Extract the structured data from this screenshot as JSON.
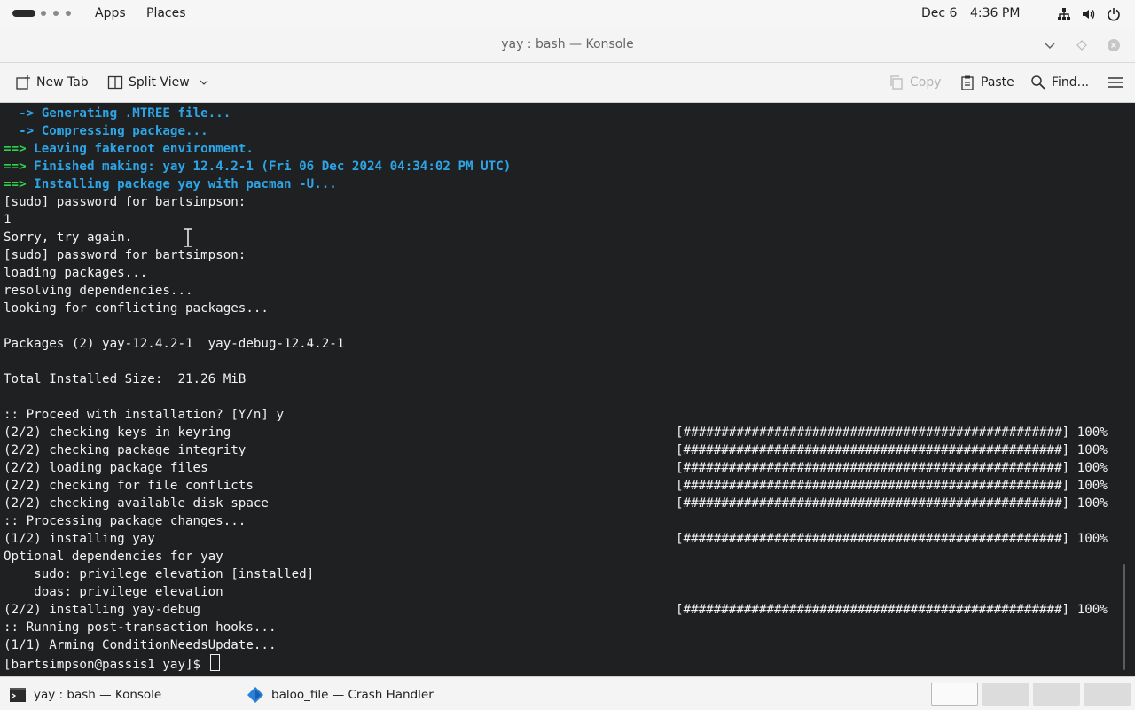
{
  "topbar": {
    "apps_label": "Apps",
    "places_label": "Places",
    "date": "Dec 6",
    "time": "4:36 PM",
    "tray_icons": [
      "network-icon",
      "volume-icon",
      "power-icon"
    ]
  },
  "window": {
    "title": "yay : bash — Konsole"
  },
  "toolbar": {
    "new_tab_label": "New Tab",
    "split_view_label": "Split View",
    "copy_label": "Copy",
    "paste_label": "Paste",
    "find_label": "Find..."
  },
  "terminal": {
    "colors": {
      "background": "#1e2022",
      "blue": "#2da5e6",
      "green": "#2bd24c"
    },
    "lines": [
      {
        "segments": [
          {
            "text": "  -> ",
            "color": "blue"
          },
          {
            "text": "Generating .MTREE file...",
            "color": "blue"
          }
        ],
        "bold": true
      },
      {
        "segments": [
          {
            "text": "  -> ",
            "color": "blue"
          },
          {
            "text": "Compressing package...",
            "color": "blue"
          }
        ],
        "bold": true
      },
      {
        "segments": [
          {
            "text": "==> ",
            "color": "green"
          },
          {
            "text": "Leaving fakeroot environment.",
            "color": "blue"
          }
        ],
        "bold": true
      },
      {
        "segments": [
          {
            "text": "==> ",
            "color": "green"
          },
          {
            "text": "Finished making: yay 12.4.2-1 (Fri 06 Dec 2024 04:34:02 PM UTC)",
            "color": "blue"
          }
        ],
        "bold": true
      },
      {
        "segments": [
          {
            "text": "==> ",
            "color": "green"
          },
          {
            "text": "Installing package yay with pacman -U...",
            "color": "blue"
          }
        ],
        "bold": true
      },
      {
        "segments": [
          {
            "text": "[sudo] password for bartsimpson:"
          }
        ]
      },
      {
        "segments": [
          {
            "text": "1"
          }
        ]
      },
      {
        "segments": [
          {
            "text": "Sorry, try again."
          }
        ]
      },
      {
        "segments": [
          {
            "text": "[sudo] password for bartsimpson:"
          }
        ]
      },
      {
        "segments": [
          {
            "text": "loading packages..."
          }
        ]
      },
      {
        "segments": [
          {
            "text": "resolving dependencies..."
          }
        ]
      },
      {
        "segments": [
          {
            "text": "looking for conflicting packages..."
          }
        ]
      },
      {
        "segments": [
          {
            "text": ""
          }
        ]
      },
      {
        "segments": [
          {
            "text": "Packages (2) yay-12.4.2-1  yay-debug-12.4.2-1"
          }
        ]
      },
      {
        "segments": [
          {
            "text": ""
          }
        ]
      },
      {
        "segments": [
          {
            "text": "Total Installed Size:  21.26 MiB"
          }
        ]
      },
      {
        "segments": [
          {
            "text": ""
          }
        ]
      },
      {
        "segments": [
          {
            "text": ":: Proceed with installation? [Y/n] y"
          }
        ]
      },
      {
        "segments": [
          {
            "text": "(2/2) checking keys in keyring"
          }
        ],
        "progress": "[##################################################] 100%"
      },
      {
        "segments": [
          {
            "text": "(2/2) checking package integrity"
          }
        ],
        "progress": "[##################################################] 100%"
      },
      {
        "segments": [
          {
            "text": "(2/2) loading package files"
          }
        ],
        "progress": "[##################################################] 100%"
      },
      {
        "segments": [
          {
            "text": "(2/2) checking for file conflicts"
          }
        ],
        "progress": "[##################################################] 100%"
      },
      {
        "segments": [
          {
            "text": "(2/2) checking available disk space"
          }
        ],
        "progress": "[##################################################] 100%"
      },
      {
        "segments": [
          {
            "text": ":: Processing package changes..."
          }
        ]
      },
      {
        "segments": [
          {
            "text": "(1/2) installing yay"
          }
        ],
        "progress": "[##################################################] 100%"
      },
      {
        "segments": [
          {
            "text": "Optional dependencies for yay"
          }
        ]
      },
      {
        "segments": [
          {
            "text": "    sudo: privilege elevation [installed]"
          }
        ]
      },
      {
        "segments": [
          {
            "text": "    doas: privilege elevation"
          }
        ]
      },
      {
        "segments": [
          {
            "text": "(2/2) installing yay-debug"
          }
        ],
        "progress": "[##################################################] 100%"
      },
      {
        "segments": [
          {
            "text": ":: Running post-transaction hooks..."
          }
        ]
      },
      {
        "segments": [
          {
            "text": "(1/1) Arming ConditionNeedsUpdate..."
          }
        ]
      }
    ],
    "prompt": "[bartsimpson@passis1 yay]$ "
  },
  "taskbar": {
    "tasks": [
      {
        "label": "yay : bash — Konsole",
        "icon": "terminal-icon"
      },
      {
        "label": "baloo_file — Crash Handler",
        "icon": "crash-handler-icon"
      }
    ],
    "workspaces": 4,
    "active_workspace": 1
  }
}
